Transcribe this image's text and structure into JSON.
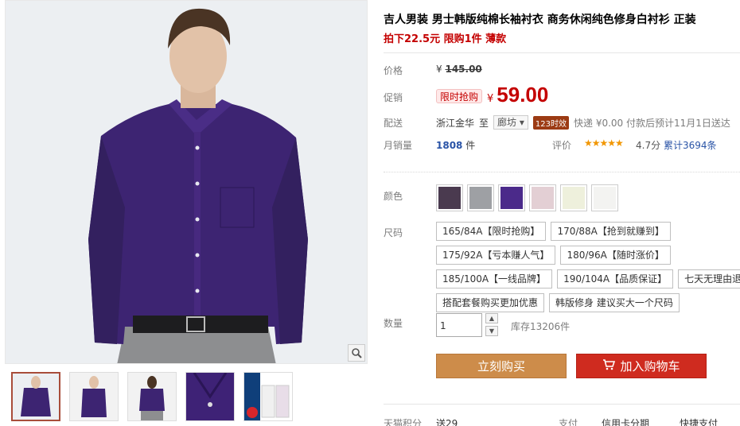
{
  "product": {
    "title": "吉人男装 男士韩版纯棉长袖衬衣 商务休闲纯色修身白衬衫 正装",
    "promo": "拍下22.5元 限购1件 薄款"
  },
  "price": {
    "label": "价格",
    "currency": "¥",
    "original": "145.00"
  },
  "promotion": {
    "label": "促销",
    "badge": "限时抢购",
    "currency": "¥",
    "price": "59.00"
  },
  "shipping": {
    "label": "配送",
    "from": "浙江金华",
    "to_word": "至",
    "city": "廊坊",
    "time_badge": "123时效",
    "fee": "快递 ¥0.00 付款后预计11月1日送达"
  },
  "sales": {
    "label": "月销量",
    "count": "1808",
    "unit": "件",
    "rating_label": "评价",
    "stars": "★★★★★",
    "score": "4.7分",
    "reviews": "累计3694条"
  },
  "color": {
    "label": "颜色",
    "swatches": [
      {
        "name": "dark-purple",
        "color": "#4a3a4f"
      },
      {
        "name": "grey",
        "color": "#9ea0a4"
      },
      {
        "name": "purple",
        "color": "#4b2a8a"
      },
      {
        "name": "pink",
        "color": "#e3cfd4"
      },
      {
        "name": "cream",
        "color": "#eef0dc"
      },
      {
        "name": "white",
        "color": "#f3f3f1"
      }
    ]
  },
  "size": {
    "label": "尺码",
    "rows": [
      [
        "165/84A【限时抢购】",
        "170/88A【抢到就赚到】"
      ],
      [
        "175/92A【亏本赚人气】",
        "180/96A【随时涨价】"
      ],
      [
        "185/100A【一线品牌】",
        "190/104A【品质保证】",
        "七天无理由退换货"
      ],
      [
        "搭配套餐购买更加优惠",
        "韩版修身 建议买大一个尺码"
      ]
    ]
  },
  "quantity": {
    "label": "数量",
    "value": "1",
    "stock": "库存13206件"
  },
  "actions": {
    "buy": "立刻购买",
    "cart": "加入购物车"
  },
  "bottom": {
    "points_label": "天猫积分",
    "points_value": "送29",
    "pay_label": "支付",
    "credit": "信用卡分期",
    "quick_pay": "快捷支付"
  },
  "colors": {
    "accent_red": "#c40000",
    "buy_orange": "#cd8c4a",
    "cart_red": "#cf2b1f",
    "link_blue": "#2953a6",
    "star_orange": "#f19600"
  }
}
